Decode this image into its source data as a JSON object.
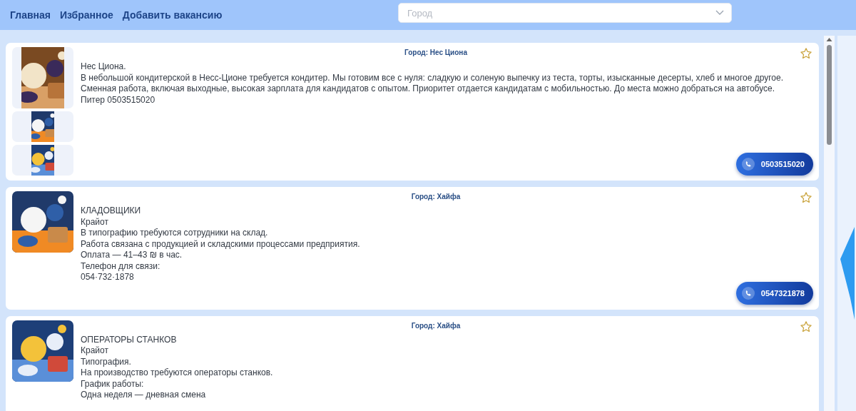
{
  "nav": [
    {
      "label": "Главная"
    },
    {
      "label": "Избранное"
    },
    {
      "label": "Добавить вакансию"
    }
  ],
  "city_select": {
    "placeholder": "Город"
  },
  "cards": [
    {
      "city": "Город: Нес Циона",
      "favorite": false,
      "images": [
        {
          "kind": "picture"
        },
        {
          "kind": "picture"
        },
        {
          "kind": "picture"
        }
      ],
      "lines": [
        "Нес Циона.",
        "В небольшой кондитерской в Несс-Ционе требуется кондитер. Мы готовим все с нуля: сладкую и соленую выпечку из теста, торты, изысканные десерты, хлеб и многое другое. Сменная работа, включая выходные, высокая зарплата для кандидатов с опытом. Приоритет отдается кандидатам с мобильностью. До места можно добраться на автобусе.",
        "Питер 0503515020"
      ],
      "phone": "0503515020"
    },
    {
      "city": "Город: Хайфа",
      "favorite": false,
      "images": [
        {
          "kind": "picture"
        }
      ],
      "lines": [
        "КЛАДОВЩИКИ",
        "Крайот",
        "В типографию требуются сотрудники на склад.",
        "Работа связана с продукцией и складскими процессами предприятия.",
        "Оплата — 41–43 ₪ в час.",
        "Телефон для связи:",
        "054·732·1878"
      ],
      "phone": "0547321878"
    },
    {
      "city": "Город: Хайфа",
      "favorite": false,
      "images": [
        {
          "kind": "picture"
        }
      ],
      "lines": [
        "ОПЕРАТОРЫ СТАНКОВ",
        "Крайот",
        "Типография.",
        "На производство требуются операторы станков.",
        "График работы:",
        "Одна неделя — дневная смена"
      ]
    }
  ]
}
